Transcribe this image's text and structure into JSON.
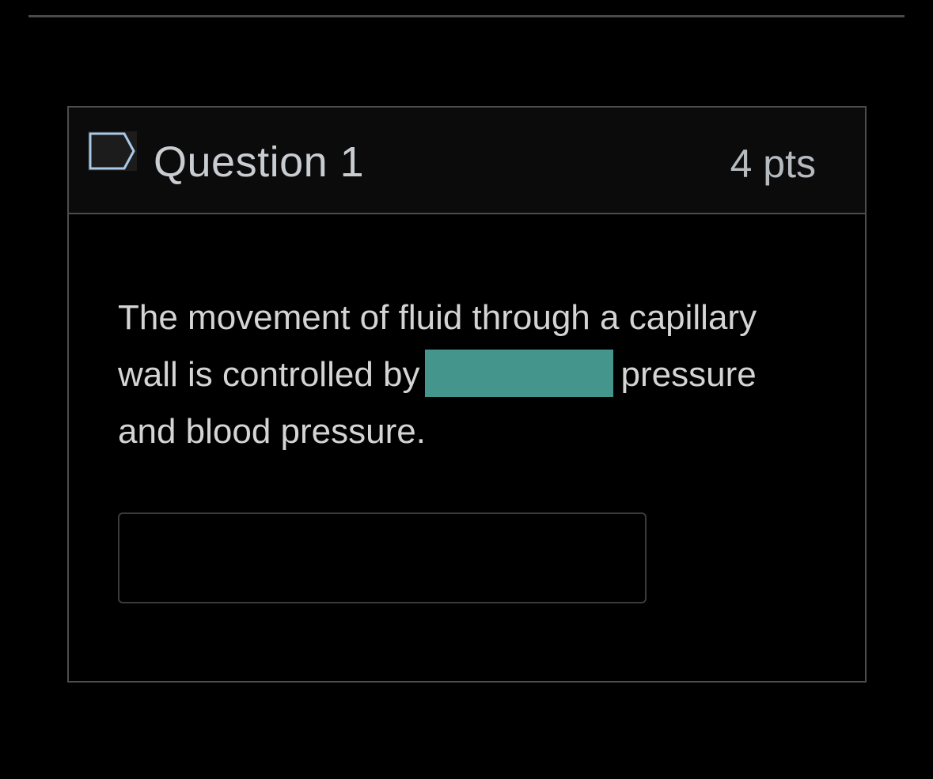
{
  "question": {
    "title": "Question 1",
    "points": "4 pts",
    "flag_icon": "flag-bookmark-icon",
    "text_before": "The movement of fluid through a capillary wall is controlled by",
    "text_after": "pressure and blood pressure.",
    "blank_color": "#44958b",
    "answer_value": "",
    "answer_placeholder": ""
  },
  "colors": {
    "background": "#000000",
    "header_background": "#0b0b0b",
    "border": "#4d4d4d",
    "text": "#d4d4d4",
    "blank_highlight": "#44958b"
  }
}
